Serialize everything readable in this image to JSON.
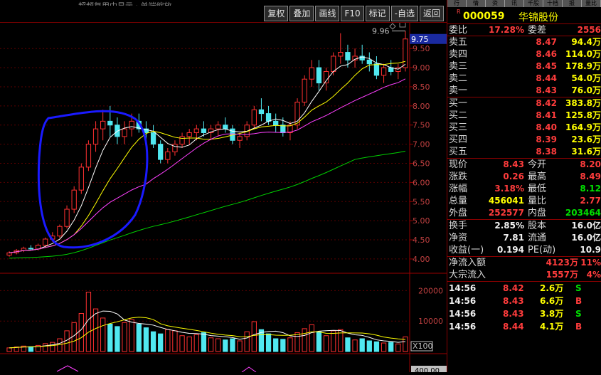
{
  "top_toolbar": {
    "obscured_text": "超频复用中显示 · 单端缩放",
    "buttons": [
      "复权",
      "叠加",
      "画线",
      "F10",
      "标记",
      "-自选",
      "返回"
    ]
  },
  "chart": {
    "price_tag": "9.75",
    "high_label": "9.96",
    "volume_tag": "X100",
    "bottom_tag": "400.00"
  },
  "chart_data": [
    {
      "type": "candlestick",
      "yaxis_ticks": [
        "9.50",
        "9.00",
        "8.50",
        "8.00",
        "7.50",
        "7.00",
        "6.50",
        "6.00",
        "5.50",
        "5.00",
        "4.50",
        "4.00"
      ],
      "ylim": [
        3.85,
        9.95
      ],
      "ma_colors": {
        "ma5": "#ffffff",
        "ma10": "#ffff00",
        "ma20": "#ff40ff",
        "ma60": "#00d000"
      },
      "candles": [
        [
          4.1,
          4.2,
          4.06,
          4.16
        ],
        [
          4.16,
          4.26,
          4.12,
          4.22
        ],
        [
          4.22,
          4.32,
          4.18,
          4.28
        ],
        [
          4.28,
          4.36,
          4.24,
          4.26
        ],
        [
          4.26,
          4.4,
          4.22,
          4.36
        ],
        [
          4.36,
          4.56,
          4.3,
          4.52
        ],
        [
          4.52,
          4.7,
          4.45,
          4.6
        ],
        [
          4.6,
          4.9,
          4.55,
          4.85
        ],
        [
          4.85,
          5.4,
          4.8,
          5.3
        ],
        [
          5.3,
          5.9,
          5.2,
          5.8
        ],
        [
          5.8,
          6.5,
          5.7,
          6.4
        ],
        [
          6.4,
          7.1,
          6.3,
          7.0
        ],
        [
          7.0,
          7.6,
          6.8,
          7.4
        ],
        [
          7.4,
          7.9,
          7.1,
          7.6
        ],
        [
          7.6,
          8.0,
          7.2,
          7.5
        ],
        [
          7.5,
          7.7,
          7.0,
          7.2
        ],
        [
          7.2,
          7.6,
          7.0,
          7.4
        ],
        [
          7.4,
          7.8,
          7.2,
          7.6
        ],
        [
          7.6,
          7.8,
          7.3,
          7.4
        ],
        [
          7.4,
          7.6,
          7.1,
          7.3
        ],
        [
          7.3,
          7.5,
          6.9,
          7.0
        ],
        [
          7.0,
          7.1,
          6.5,
          6.6
        ],
        [
          6.6,
          6.9,
          6.5,
          6.8
        ],
        [
          6.8,
          7.1,
          6.7,
          7.0
        ],
        [
          7.0,
          7.3,
          6.9,
          7.2
        ],
        [
          7.2,
          7.4,
          7.0,
          7.3
        ],
        [
          7.3,
          7.5,
          7.1,
          7.4
        ],
        [
          7.4,
          7.6,
          7.2,
          7.3
        ],
        [
          7.3,
          7.5,
          7.1,
          7.4
        ],
        [
          7.4,
          7.6,
          7.2,
          7.5
        ],
        [
          7.5,
          7.7,
          7.3,
          7.4
        ],
        [
          7.4,
          7.5,
          7.0,
          7.1
        ],
        [
          7.1,
          7.3,
          6.9,
          7.2
        ],
        [
          7.2,
          7.6,
          7.1,
          7.5
        ],
        [
          7.5,
          8.0,
          7.4,
          7.9
        ],
        [
          7.9,
          8.2,
          7.6,
          7.8
        ],
        [
          7.8,
          8.0,
          7.5,
          7.6
        ],
        [
          7.6,
          7.8,
          7.3,
          7.5
        ],
        [
          7.5,
          7.7,
          7.2,
          7.3
        ],
        [
          7.3,
          7.6,
          7.1,
          7.5
        ],
        [
          7.5,
          8.2,
          7.4,
          8.1
        ],
        [
          8.1,
          8.8,
          8.0,
          8.7
        ],
        [
          8.7,
          9.2,
          8.5,
          9.0
        ],
        [
          9.0,
          9.2,
          8.4,
          8.6
        ],
        [
          8.6,
          9.0,
          8.4,
          8.9
        ],
        [
          8.9,
          9.4,
          8.8,
          9.3
        ],
        [
          9.3,
          9.9,
          9.1,
          9.4
        ],
        [
          9.4,
          9.6,
          9.0,
          9.2
        ],
        [
          9.2,
          9.5,
          9.0,
          9.3
        ],
        [
          9.3,
          9.6,
          9.1,
          9.2
        ],
        [
          9.2,
          9.4,
          8.9,
          9.1
        ],
        [
          9.1,
          9.3,
          8.7,
          8.8
        ],
        [
          8.8,
          9.1,
          8.6,
          9.0
        ],
        [
          9.0,
          9.2,
          8.8,
          8.9
        ],
        [
          8.9,
          9.1,
          8.7,
          9.0
        ],
        [
          9.0,
          9.96,
          8.9,
          9.75
        ]
      ]
    },
    {
      "type": "bar",
      "yaxis_ticks": [
        "20000",
        "10000"
      ],
      "ylim": [
        0,
        25000
      ],
      "values": [
        1200,
        1500,
        1800,
        1600,
        2000,
        2600,
        3000,
        4200,
        6800,
        9500,
        12500,
        19500,
        14000,
        11000,
        9000,
        8200,
        9500,
        10500,
        9000,
        7800,
        6500,
        5800,
        7200,
        6800,
        5200,
        4800,
        5500,
        6200,
        4500,
        4200,
        3800,
        4200,
        3500,
        6500,
        9800,
        7200,
        5800,
        4200,
        4000,
        4500,
        6200,
        7500,
        8800,
        6500,
        5200,
        6800,
        7200,
        4500,
        3800,
        4200,
        3500,
        3200,
        2800,
        3000,
        2500,
        4800
      ]
    }
  ],
  "panel": {
    "tabs": [
      "行",
      "情",
      "资",
      "讯",
      "千股",
      "十档",
      "报",
      "量比"
    ],
    "code": "000059",
    "name": "华锦股份",
    "webi": {
      "label": "委比",
      "value": "17.28%",
      "label2": "委差",
      "value2": "2556"
    },
    "sells": [
      {
        "label": "卖五",
        "price": "8.47",
        "vol": "94.4万"
      },
      {
        "label": "卖四",
        "price": "8.46",
        "vol": "114.0万"
      },
      {
        "label": "卖三",
        "price": "8.45",
        "vol": "178.9万"
      },
      {
        "label": "卖二",
        "price": "8.44",
        "vol": "54.0万"
      },
      {
        "label": "卖一",
        "price": "8.43",
        "vol": "76.0万"
      }
    ],
    "buys": [
      {
        "label": "买一",
        "price": "8.42",
        "vol": "383.8万"
      },
      {
        "label": "买二",
        "price": "8.41",
        "vol": "125.8万"
      },
      {
        "label": "买三",
        "price": "8.40",
        "vol": "164.9万"
      },
      {
        "label": "买四",
        "price": "8.39",
        "vol": "23.6万"
      },
      {
        "label": "买五",
        "price": "8.38",
        "vol": "31.6万"
      }
    ],
    "quote": [
      {
        "l1": "现价",
        "v1": "8.43",
        "c1": "red",
        "l2": "今开",
        "v2": "8.20",
        "c2": "red"
      },
      {
        "l1": "涨跌",
        "v1": "0.26",
        "c1": "red",
        "l2": "最高",
        "v2": "8.49",
        "c2": "red"
      },
      {
        "l1": "涨幅",
        "v1": "3.18%",
        "c1": "red",
        "l2": "最低",
        "v2": "8.12",
        "c2": "grn"
      },
      {
        "l1": "总量",
        "v1": "456041",
        "c1": "yel",
        "l2": "量比",
        "v2": "2.77",
        "c2": "red"
      },
      {
        "l1": "外盘",
        "v1": "252577",
        "c1": "red",
        "l2": "内盘",
        "v2": "203464",
        "c2": "grn"
      }
    ],
    "fund": [
      {
        "l1": "换手",
        "v1": "2.85%",
        "l2": "股本",
        "v2": "16.0亿"
      },
      {
        "l1": "净资",
        "v1": "7.81",
        "l2": "流通",
        "v2": "16.0亿"
      },
      {
        "l1": "收益(一)",
        "v1": "0.194",
        "l2": "PE(动)",
        "v2": "10.9"
      }
    ],
    "flow": [
      {
        "label": "净流入额",
        "amount": "4123万",
        "pct": "11%"
      },
      {
        "label": "大宗流入",
        "amount": "1557万",
        "pct": "4%"
      }
    ],
    "trades": [
      {
        "time": "14:56",
        "price": "8.42",
        "vol": "2.6万",
        "side": "S"
      },
      {
        "time": "14:56",
        "price": "8.43",
        "vol": "6.6万",
        "side": "B"
      },
      {
        "time": "14:56",
        "price": "8.43",
        "vol": "3.8万",
        "side": "S"
      },
      {
        "time": "14:56",
        "price": "8.44",
        "vol": "4.1万",
        "side": "B"
      }
    ]
  }
}
